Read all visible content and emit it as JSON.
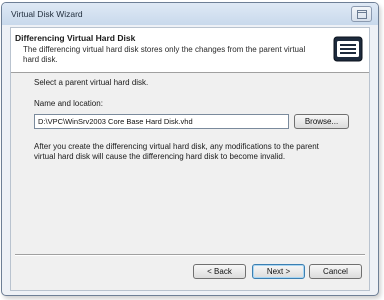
{
  "window": {
    "title": "Virtual Disk Wizard"
  },
  "header": {
    "title": "Differencing Virtual Hard Disk",
    "description": "The differencing virtual hard disk stores only the changes from the parent virtual hard disk.",
    "icon": "hard-disk-icon"
  },
  "body": {
    "prompt": "Select a parent virtual hard disk.",
    "name_label": "Name and location:",
    "path_value": "D:\\VPC\\WinSrv2003 Core Base Hard Disk.vhd",
    "browse_label": "Browse...",
    "info_text": "After you create the differencing virtual hard disk, any modifications to the parent virtual hard disk will cause the differencing hard disk to become invalid."
  },
  "footer": {
    "back_label": "< Back",
    "next_label": "Next >",
    "cancel_label": "Cancel"
  }
}
